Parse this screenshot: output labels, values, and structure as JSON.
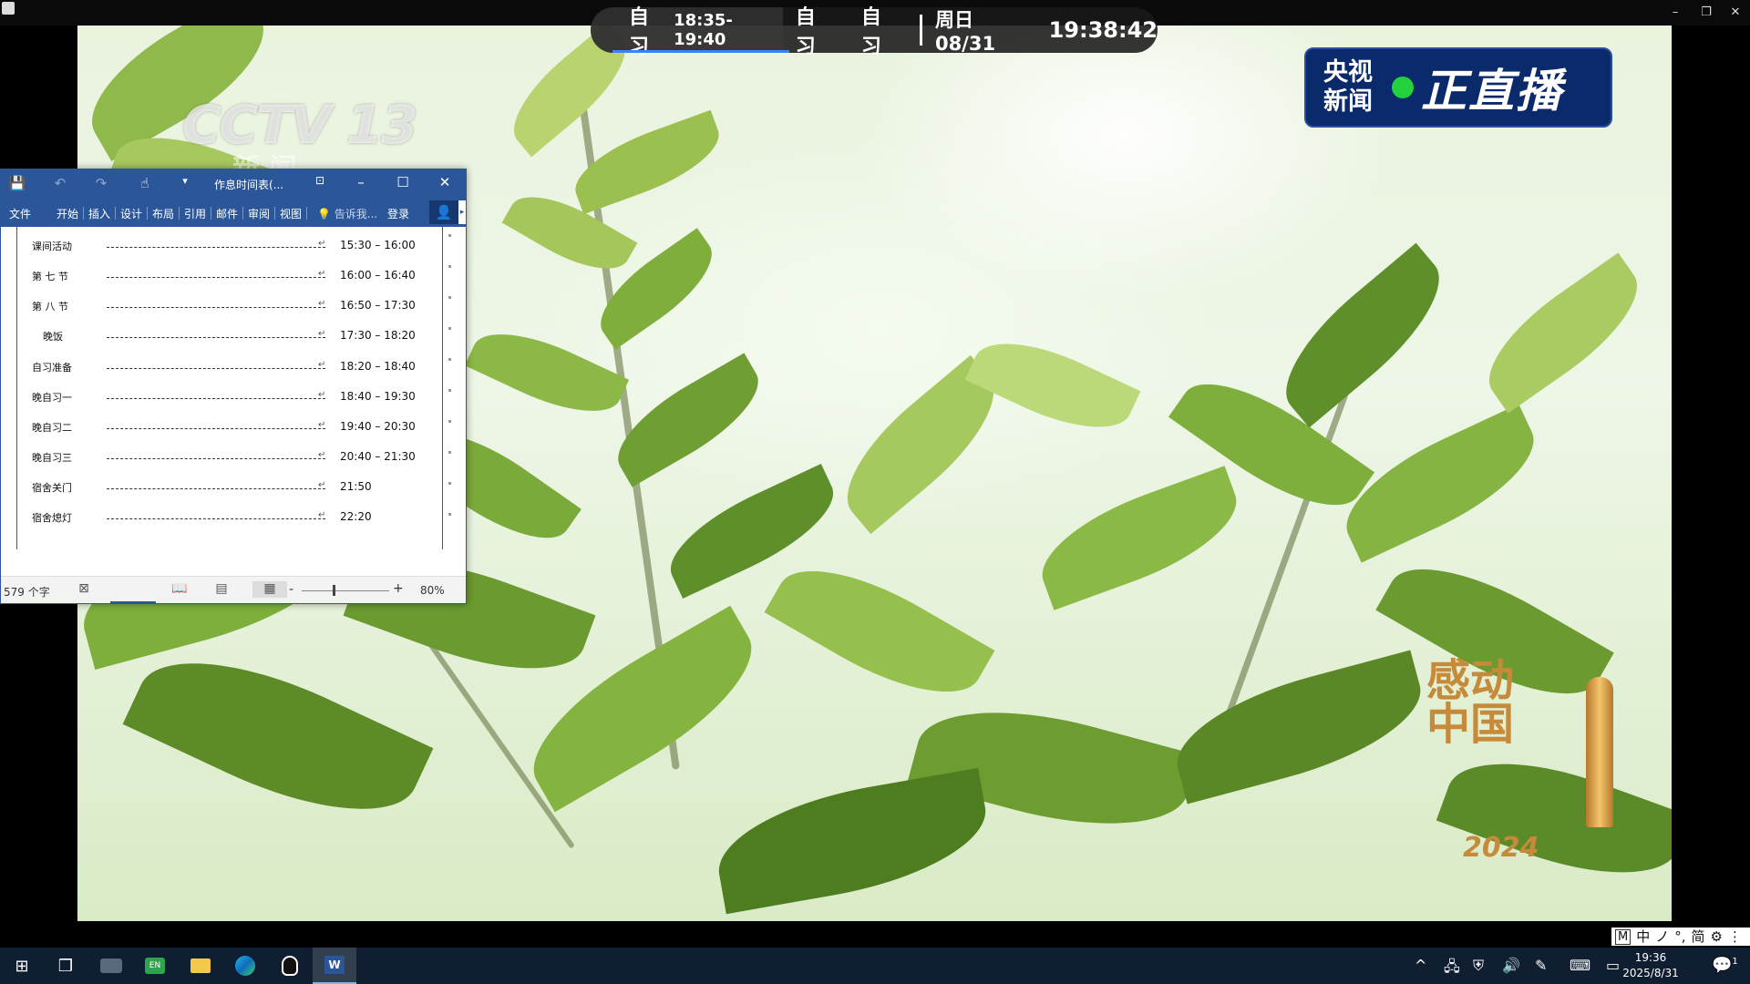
{
  "schedule_bar": {
    "current_label": "自习",
    "current_range": "18:35-19:40",
    "next_label_1": "自习",
    "next_label_2": "自习",
    "date": "周日 08/31",
    "clock": "19:38:42"
  },
  "video_overlay": {
    "channel_logo": "CCTV 13",
    "channel_sub": "新 闻",
    "live_badge_left": "央视\n新闻",
    "live_badge_right": "正直播",
    "program_logo_text": "感动中国",
    "program_logo_year": "2024"
  },
  "word": {
    "title": "作息时间表(...",
    "ribbon_tabs": [
      "文件",
      "开始",
      "插入",
      "设计",
      "布局",
      "引用",
      "邮件",
      "审阅",
      "视图"
    ],
    "tell_me": "告诉我...",
    "login": "登录",
    "schedule_rows": [
      {
        "label": "课间活动",
        "time": "15:30 – 16:00"
      },
      {
        "label": "第 七 节",
        "time": "16:00 – 16:40"
      },
      {
        "label": "第 八 节",
        "time": "16:50 – 17:30"
      },
      {
        "label": "晚饭",
        "time": "17:30 – 18:20"
      },
      {
        "label": "自习准备",
        "time": "18:20 – 18:40"
      },
      {
        "label": "晚自习一",
        "time": "18:40 – 19:30"
      },
      {
        "label": "晚自习二",
        "time": "19:40 – 20:30"
      },
      {
        "label": "晚自习三",
        "time": "20:40 – 21:30"
      },
      {
        "label": "宿舍关门",
        "time": "21:50"
      },
      {
        "label": "宿舍熄灯",
        "time": "22:20"
      }
    ],
    "status_word_count": "579 个字",
    "zoom": "80%"
  },
  "ime": {
    "items": [
      "M",
      "中",
      "ノ",
      "°,",
      "简",
      "⚙",
      "⋮"
    ]
  },
  "taskbar": {
    "time": "19:36",
    "date": "2025/8/31",
    "notification_count": "1"
  },
  "colors": {
    "word_blue": "#2b579a",
    "taskbar_bg": "#0f1e31",
    "live_badge_bg": "#0b2a6b",
    "live_dot": "#23d13f",
    "schedule_underline": "#3b82f6"
  }
}
